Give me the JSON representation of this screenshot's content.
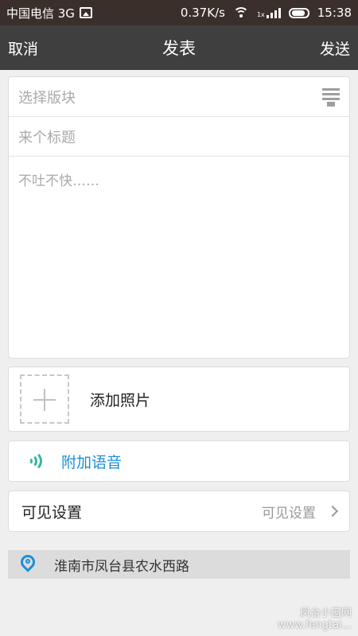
{
  "status_bar": {
    "carrier": "中国电信 3G",
    "speed": "0.37K/s",
    "time": "15:38",
    "signal_label": "1x"
  },
  "header": {
    "cancel_label": "取消",
    "title": "发表",
    "send_label": "发送"
  },
  "compose": {
    "section_placeholder": "选择版块",
    "title_placeholder": "来个标题",
    "content_placeholder": "不吐不快……"
  },
  "photo": {
    "label": "添加照片"
  },
  "voice": {
    "label": "附加语音",
    "accent_color": "#1a8fd8",
    "icon_color": "#35b7a1"
  },
  "visibility": {
    "label": "可见设置",
    "value": "可见设置"
  },
  "location": {
    "text": "淮南市凤台县农水西路"
  },
  "watermark": {
    "line1": "凤台小窗网",
    "line2": "www.fengtai..."
  }
}
